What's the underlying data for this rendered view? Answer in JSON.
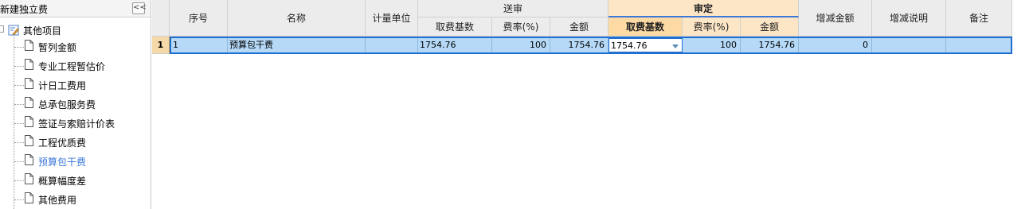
{
  "left_panel": {
    "title": "新建独立费",
    "collapse_label": "<<",
    "root": {
      "label": "其他项目"
    },
    "items": [
      {
        "label": "暂列金额"
      },
      {
        "label": "专业工程暂估价"
      },
      {
        "label": "计日工费用"
      },
      {
        "label": "总承包服务费"
      },
      {
        "label": "签证与索赔计价表"
      },
      {
        "label": "工程优质费"
      },
      {
        "label": "预算包干费",
        "selected": true
      },
      {
        "label": "概算幅度差"
      },
      {
        "label": "其他费用"
      }
    ]
  },
  "grid": {
    "headers": {
      "seq": "序号",
      "name": "名称",
      "unit": "计量单位",
      "submit_group": "送审",
      "submit_base": "取费基数",
      "submit_rate": "费率(%)",
      "submit_amount": "金额",
      "review_group": "审定",
      "review_base": "取费基数",
      "review_rate": "费率(%)",
      "review_amount": "金额",
      "diff_amount": "增减金额",
      "diff_note": "增减说明",
      "remark": "备注"
    },
    "rows": [
      {
        "row_number": "1",
        "seq": "1",
        "name": "预算包干费",
        "unit": "",
        "submit_base": "1754.76",
        "submit_rate": "100",
        "submit_amount": "1754.76",
        "review_base": "1754.76",
        "review_rate": "100",
        "review_amount": "1754.76",
        "diff_amount": "0",
        "diff_note": "",
        "remark": ""
      }
    ]
  },
  "colors": {
    "selection": "#b5d9f7",
    "selection_border": "#1f6fd1",
    "review_header": "#fde6c6",
    "selected_tree_item": "#3c78d8"
  }
}
